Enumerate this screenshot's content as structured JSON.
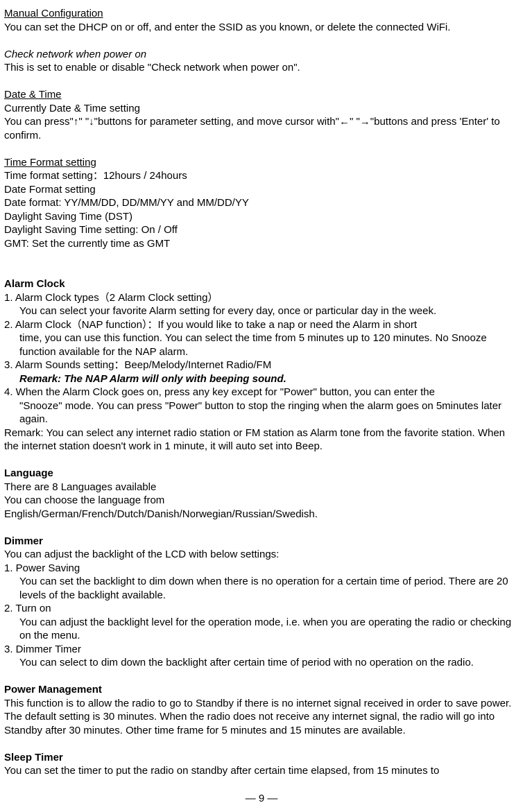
{
  "s1": {
    "title": "Manual Configuration",
    "body": "You can set the DHCP on or off, and enter the SSID as you known, or delete the connected WiFi."
  },
  "s2": {
    "title": "Check network when power on",
    "body": "This is set to enable or disable \"Check network when power on\"."
  },
  "s3": {
    "title": "Date & Time",
    "l1": "Currently Date & Time setting",
    "l2": "You can press\"↑\" \"↓\"buttons for parameter setting, and move cursor with\"←\" \"→\"buttons and press 'Enter' to confirm."
  },
  "s4": {
    "title": "Time Format setting",
    "l1": "Time format setting：12hours / 24hours",
    "l2": "Date Format setting",
    "l3": "Date format: YY/MM/DD, DD/MM/YY and MM/DD/YY",
    "l4": "Daylight Saving Time (DST)",
    "l5": "Daylight Saving Time setting: On / Off",
    "l6": "GMT: Set the currently time as GMT"
  },
  "alarm": {
    "title": "Alarm Clock",
    "i1a": "1. Alarm Clock types（2 Alarm Clock setting）",
    "i1b": "You can select your favorite Alarm setting for every day, once or particular day in the week.",
    "i2a": "2. Alarm Clock（NAP function）：If you would like to take a nap or need the Alarm in short",
    "i2b": "time, you can use this function. You can select the time from 5 minutes up to 120 minutes. No Snooze function available for the NAP alarm.",
    "i3a": "3. Alarm Sounds setting：Beep/Melody/Internet Radio/FM",
    "i3b": "Remark: The NAP Alarm will only with beeping sound.",
    "i4a": "4. When the Alarm Clock goes on, press any key except for \"Power\" button, you can enter the",
    "i4b": "\"Snooze\" mode. You can press \"Power\" button to stop the ringing when the alarm goes on 5minutes later again.",
    "remark": "Remark: You can select any internet radio station or FM station as Alarm tone from the favorite station. When the internet station doesn't work in 1 minute, it will auto set into Beep."
  },
  "lang": {
    "title": "Language",
    "l1": "There are 8 Languages available",
    "l2": "You can choose the language from",
    "l3": "English/German/French/Dutch/Danish/Norwegian/Russian/Swedish."
  },
  "dimmer": {
    "title": "Dimmer",
    "intro": "You can adjust the backlight of the LCD with below settings:",
    "i1a": "1. Power Saving",
    "i1b": "You can set the backlight to dim down when there is no operation for a certain time of period. There are 20 levels of the backlight available.",
    "i2a": "2. Turn on",
    "i2b": "You can adjust the backlight level for the operation mode, i.e. when you are operating the radio or checking on the menu.",
    "i3a": "3. Dimmer Timer",
    "i3b": "You can select to dim down the backlight after certain time of period with no operation on the radio."
  },
  "power": {
    "title": "Power Management",
    "body": "This function is to allow the radio to go to Standby if there is no internet signal received in order to save power. The default setting is 30 minutes. When the radio does not receive any internet signal, the radio will go into Standby after 30 minutes. Other time frame for 5 minutes and 15 minutes are available."
  },
  "sleep": {
    "title": "Sleep Timer",
    "body": "You can set the timer to put the radio on standby after certain time elapsed, from 15 minutes to"
  },
  "pageNumber": "—  9  —"
}
